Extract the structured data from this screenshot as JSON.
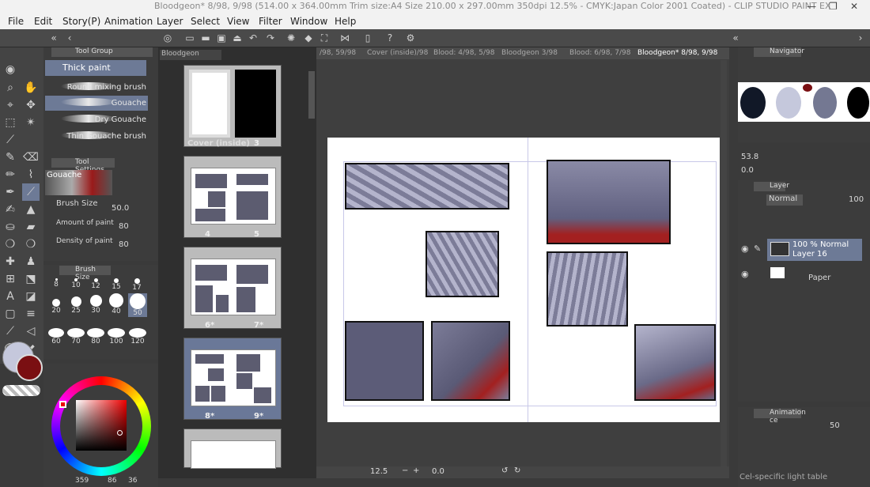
{
  "window": {
    "title": "Bloodgeon* 8/98, 9/98 (514.00 x 364.00mm Trim size:A4 Size 210.00 x 297.00mm 350dpi 12.5% - CMYK:Japan Color 2001 Coated) - CLIP STUDIO PAINT EX",
    "min": "—",
    "max": "❐",
    "close": "✕"
  },
  "menu": [
    "File",
    "Edit",
    "Story(P)",
    "Animation",
    "Layer",
    "Select",
    "View",
    "Filter",
    "Window",
    "Help"
  ],
  "subtool": {
    "group_tab": "Tool Group",
    "tab": "Thick paint",
    "brushes": [
      "Round mixing brush",
      "Gouache",
      "Dry Gouache",
      "Thin Gouache brush"
    ]
  },
  "tool_settings": {
    "tab": "Tool Settings",
    "preview": "Gouache",
    "brush_size_label": "Brush Size",
    "brush_size": "50.0",
    "amount_label": "Amount of paint",
    "amount": "80",
    "density_label": "Density of paint",
    "density": "80"
  },
  "brush_size_panel": {
    "tab": "Brush Size",
    "sizes": [
      "8",
      "10",
      "12",
      "15",
      "17",
      "20",
      "25",
      "30",
      "40",
      "50",
      "60",
      "70",
      "80",
      "100",
      "120"
    ]
  },
  "colors": {
    "main": "#c5c8dc",
    "sub": "#7a0f12",
    "accent": "#6d7a96",
    "stats": "359",
    "stat2": "86",
    "stat3": "36"
  },
  "pages": {
    "tab": "Bloodgeon",
    "items": [
      {
        "l": "Cover (inside)",
        "r": "3"
      },
      {
        "l": "4",
        "r": "5"
      },
      {
        "l": "6*",
        "r": "7*"
      },
      {
        "l": "8*",
        "r": "9*"
      }
    ]
  },
  "doc_tabs": [
    "/98, 59/98",
    "Cover (inside)/98",
    "Blood: 4/98, 5/98",
    "Bloodgeon  3/98",
    "Blood: 6/98, 7/98",
    "Bloodgeon* 8/98, 9/98"
  ],
  "navigator": {
    "tab": "Navigator",
    "zoom": "53.8",
    "rotate": "0.0"
  },
  "layer": {
    "tab": "Layer",
    "blend": "Normal",
    "opacity": "100",
    "layers": [
      {
        "line1": "100 % Normal",
        "line2": "Layer 16"
      },
      {
        "line1": "",
        "line2": "Paper"
      }
    ]
  },
  "animation": {
    "tab": "Animation ce",
    "value": "50",
    "footer": "Cel-specific light table"
  },
  "status": {
    "zoom": "12.5",
    "angle": "0.0"
  }
}
